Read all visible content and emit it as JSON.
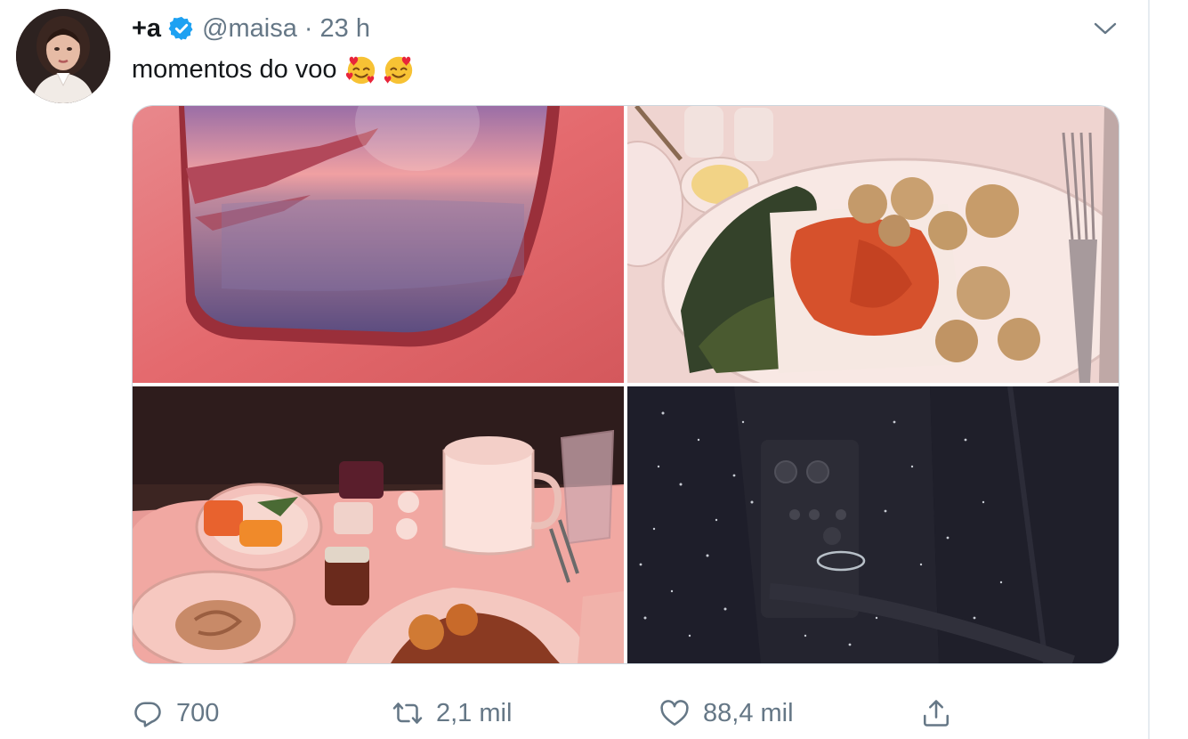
{
  "tweet": {
    "display_name": "+a",
    "handle": "@maisa",
    "separator": "·",
    "time": "23 h",
    "text": "momentos do voo",
    "emoji": [
      "smiling-face-with-hearts",
      "smiling-face-with-hearts"
    ]
  },
  "media": [
    {
      "subject": "airplane-window-photo"
    },
    {
      "subject": "meal-plate-photo"
    },
    {
      "subject": "breakfast-tray-photo"
    },
    {
      "subject": "cabin-ceiling-photo"
    }
  ],
  "actions": {
    "reply_count": "700",
    "retweet_count": "2,1 mil",
    "like_count": "88,4 mil"
  },
  "colors": {
    "verified": "#1da1f2",
    "muted_text": "#657786",
    "primary_text": "#14171a",
    "border": "#e6ecf0"
  }
}
